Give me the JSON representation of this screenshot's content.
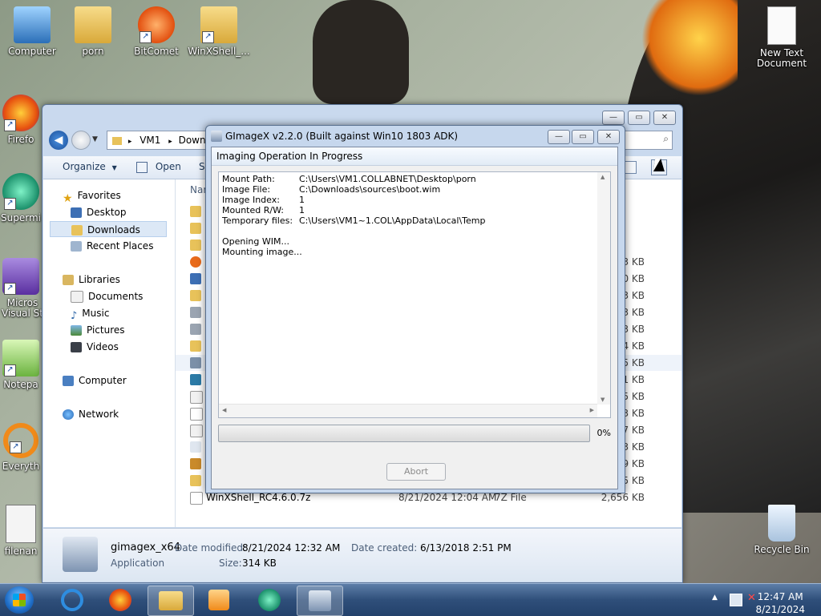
{
  "desktop": {
    "icons": [
      {
        "label": "Computer"
      },
      {
        "label": "porn"
      },
      {
        "label": "BitComet"
      },
      {
        "label": "WinXShell_..."
      },
      {
        "label": "New Text Document"
      },
      {
        "label": "Firefo"
      },
      {
        "label": "Supermi"
      },
      {
        "label": "Micros Visual St"
      },
      {
        "label": "Notepa"
      },
      {
        "label": "Everyth"
      },
      {
        "label": "filenan"
      },
      {
        "label": "Recycle Bin"
      }
    ]
  },
  "explorer": {
    "address": [
      "VM1",
      "Downlo"
    ],
    "toolbar": {
      "organize": "Organize",
      "open": "Open",
      "share": "Sh"
    },
    "nav": {
      "favorites": "Favorites",
      "desktop": "Desktop",
      "downloads": "Downloads",
      "recent": "Recent Places",
      "libraries": "Libraries",
      "documents": "Documents",
      "music": "Music",
      "pictures": "Pictures",
      "videos": "Videos",
      "computer": "Computer",
      "network": "Network"
    },
    "column_name": "Nar",
    "sizes": [
      "3 KB",
      "0 KB",
      "3 KB",
      "3 KB",
      "3 KB",
      "4 KB",
      "5 KB",
      "1 KB",
      "5 KB",
      "3 KB",
      "7 KB",
      "3 KB",
      "9 KB",
      "5 KB"
    ],
    "last_file": {
      "name": "WinXShell_RC4.6.0.7z",
      "date": "8/21/2024 12:04 AM",
      "type": "7Z File",
      "size": "2,656 KB"
    },
    "details": {
      "name": "gimagex_x64",
      "type": "Application",
      "modified_label": "Date modified:",
      "modified": "8/21/2024 12:32 AM",
      "created_label": "Date created:",
      "created": "6/13/2018 2:51 PM",
      "size_label": "Size:",
      "size": "314 KB"
    }
  },
  "gimagex": {
    "title": "GImageX v2.2.0 (Built against Win10 1803 ADK)",
    "header": "Imaging Operation In Progress",
    "log": [
      {
        "label": "Mount Path:",
        "value": "C:\\Users\\VM1.COLLABNET\\Desktop\\porn"
      },
      {
        "label": "Image File:",
        "value": "C:\\Downloads\\sources\\boot.wim"
      },
      {
        "label": "Image Index:",
        "value": "1"
      },
      {
        "label": "Mounted R/W:",
        "value": "1"
      },
      {
        "label": "Temporary files:",
        "value": "C:\\Users\\VM1~1.COL\\AppData\\Local\\Temp"
      }
    ],
    "status": [
      "Opening WIM...",
      "Mounting image..."
    ],
    "progress": 0,
    "progress_label": "0%",
    "abort_label": "Abort"
  },
  "taskbar": {
    "time": "12:47 AM",
    "date": "8/21/2024"
  },
  "colors": {
    "accent": "#1f6ec8",
    "progress_fill": "#35b535",
    "folder": "#e8c25a"
  }
}
